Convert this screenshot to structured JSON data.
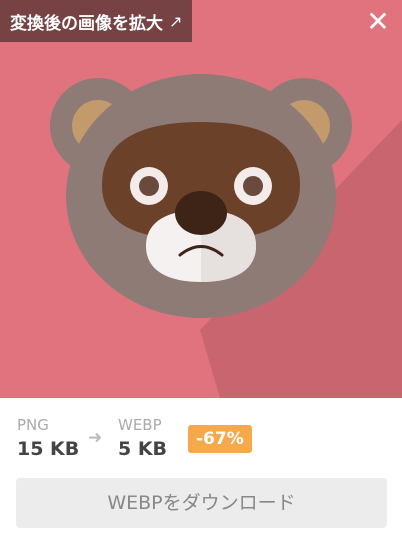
{
  "header": {
    "enlarge_label": "変換後の画像を拡大",
    "enlarge_icon": "external-arrow-icon",
    "close_icon": "close-icon"
  },
  "preview": {
    "subject": "bear face illustration",
    "colors": {
      "background": "#e0737d",
      "fur": "#8f7b76",
      "inner_ear": "#c29a6b",
      "mask": "#6b4129",
      "muzzle": "#f5f1f0",
      "nose": "#3e2416"
    }
  },
  "conversion": {
    "source_format": "PNG",
    "source_size": "15 KB",
    "target_format": "WEBP",
    "target_size": "5 KB",
    "reduction": "-67%",
    "arrow_icon": "arrow-right-icon"
  },
  "actions": {
    "download_label": "WEBPをダウンロード"
  },
  "colors": {
    "badge_background": "#5f3737",
    "reduction_badge": "#f5a94a",
    "download_button": "#ececec"
  }
}
